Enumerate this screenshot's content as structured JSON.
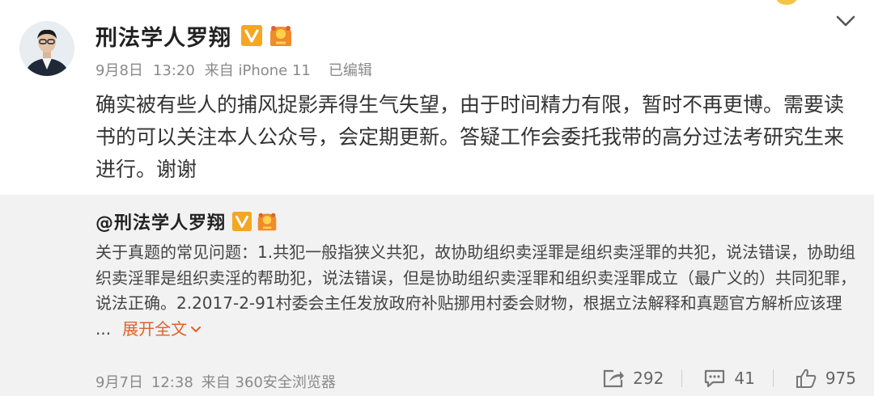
{
  "post": {
    "author": "刑法学人罗翔",
    "date": "9月8日",
    "time": "13:20",
    "source": "来自 iPhone 11",
    "edited": "已编辑",
    "text": "确实被有些人的捕风捉影弄得生气失望，由于时间精力有限，暂时不再更博。需要读书的可以关注本人公众号，会定期更新。答疑工作会委托我带的高分过法考研究生来进行。谢谢"
  },
  "repost": {
    "author": "@刑法学人罗翔",
    "text": "关于真题的常见问题：1.共犯一般指狭义共犯，故协助组织卖淫罪是组织卖淫罪的共犯，说法错误，协助组织卖淫罪是组织卖淫的帮助犯，说法错误，但是协助组织卖淫罪和组织卖淫罪成立（最广义的）共同犯罪，说法正确。2.2017-2-91村委会主任发放政府补贴挪用村委会财物，根据立法解释和真题官方解析应该理 ...",
    "expand_label": "展开全文",
    "date": "9月7日",
    "time": "12:38",
    "source": "来自 360安全浏览器",
    "repost_count": "292",
    "comment_count": "41",
    "like_count": "975"
  },
  "icons": {
    "verified": "verified-v-badge",
    "fan": "fan-badge-icon",
    "menu": "chevron-down-icon",
    "repost": "repost-icon",
    "comment": "comment-icon",
    "like": "thumbs-up-icon"
  },
  "colors": {
    "accent_orange": "#e0602d",
    "badge_orange": "#f5a623",
    "repost_bg": "#f2f2f2"
  }
}
